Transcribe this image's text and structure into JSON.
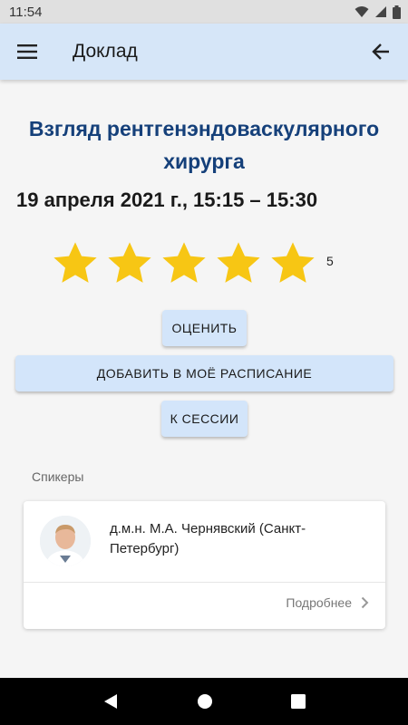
{
  "status_bar": {
    "time": "11:54"
  },
  "app_bar": {
    "title": "Доклад"
  },
  "talk": {
    "title": "Взгляд рентгенэндоваскулярного хирурга",
    "datetime": "19 апреля 2021 г., 15:15 – 15:30",
    "rating": {
      "value": 5,
      "max": 5,
      "display": "5"
    }
  },
  "buttons": {
    "rate": "ОЦЕНИТЬ",
    "add_schedule": "ДОБАВИТЬ В МОЁ РАСПИСАНИЕ",
    "to_session": "К СЕССИИ"
  },
  "speakers": {
    "label": "Спикеры",
    "items": [
      {
        "name": "д.м.н. М.А. Чернявский (Санкт-Петербург)",
        "more": "Подробнее"
      }
    ]
  },
  "colors": {
    "app_bar": "#d6e6f8",
    "title_text": "#15407a",
    "star": "#f7c614",
    "button": "#d3e5fa"
  }
}
